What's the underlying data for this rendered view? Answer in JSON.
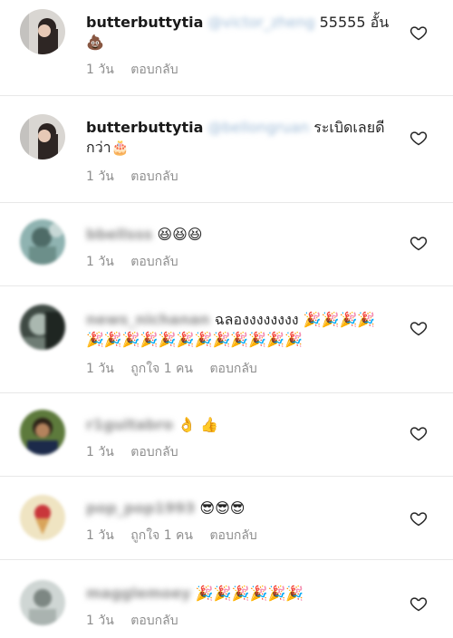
{
  "comments": [
    {
      "username": "butterbuttytia",
      "mention": "@victor_zheng",
      "text": "55555 อั้น",
      "text2": "💩",
      "time": "1 วัน",
      "likes": "",
      "reply": "ตอบกลับ"
    },
    {
      "username": "butterbuttytia",
      "mention": "@bellongruan",
      "text": "ระเบิดเลยดี",
      "text2": "กว่า🎂",
      "time": "1 วัน",
      "likes": "",
      "reply": "ตอบกลับ"
    },
    {
      "username": "bbellsss",
      "mention": "",
      "text": "😆😆😆",
      "text2": "",
      "time": "1 วัน",
      "likes": "",
      "reply": "ตอบกลับ"
    },
    {
      "username": "news_nichanan",
      "mention": "",
      "text": "ฉลองงงงงงงง 🎉🎉🎉🎉",
      "text2": "🎉🎉🎉🎉🎉🎉🎉🎉🎉🎉🎉🎉",
      "time": "1 วัน",
      "likes": "ถูกใจ 1 คน",
      "reply": "ตอบกลับ"
    },
    {
      "username": "r1guitabro",
      "mention": "",
      "text": "👌 👍",
      "text2": "",
      "time": "1 วัน",
      "likes": "",
      "reply": "ตอบกลับ"
    },
    {
      "username": "pop_pop1993",
      "mention": "",
      "text": "😎😎😎",
      "text2": "",
      "time": "1 วัน",
      "likes": "ถูกใจ 1 คน",
      "reply": "ตอบกลับ"
    },
    {
      "username": "magglemoey",
      "mention": "",
      "text": "🎉🎉🎉🎉🎉🎉",
      "text2": "",
      "time": "1 วัน",
      "likes": "",
      "reply": "ตอบกลับ"
    }
  ]
}
